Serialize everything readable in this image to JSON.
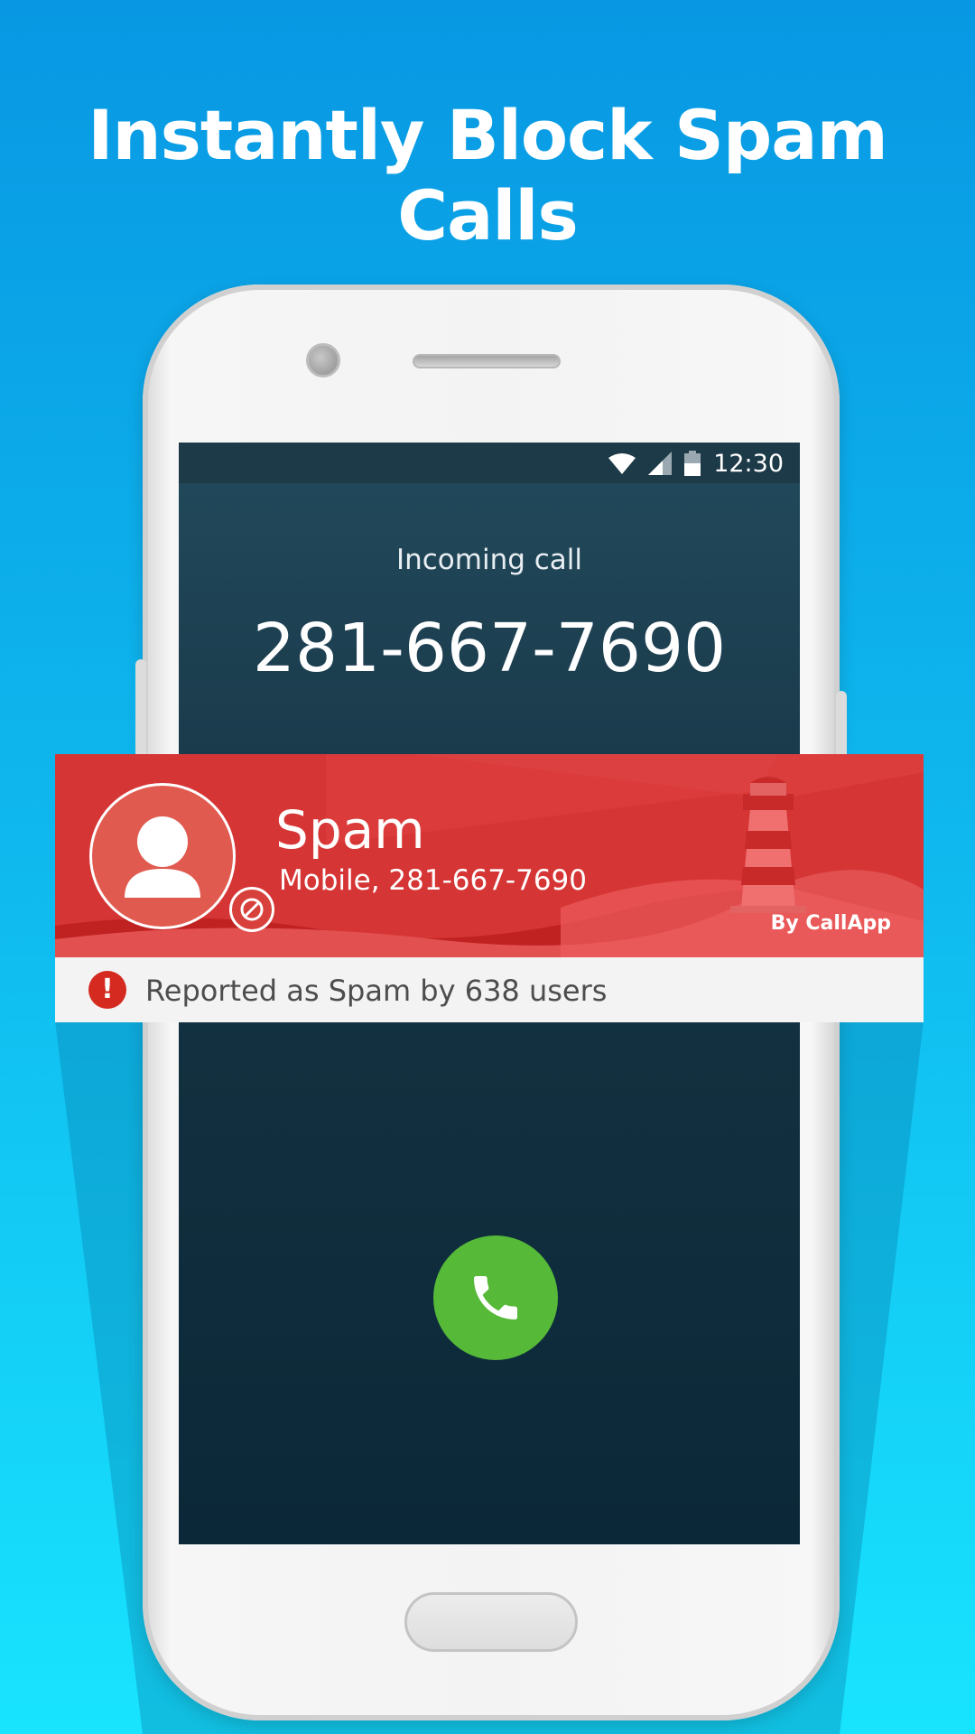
{
  "headline": "Instantly Block Spam Calls",
  "status_bar": {
    "time": "12:30",
    "icons": [
      "wifi-icon",
      "signal-icon",
      "battery-icon"
    ]
  },
  "call": {
    "label": "Incoming call",
    "number": "281-667-7690"
  },
  "caller_id": {
    "name": "Spam",
    "subtitle": "Mobile, 281-667-7690",
    "brand": "By CallApp",
    "accent_color": "#d63535"
  },
  "report": {
    "text": "Reported as Spam by 638 users",
    "icon": "alert-icon"
  },
  "actions": {
    "answer_icon": "phone-icon",
    "answer_color": "#56b938"
  }
}
